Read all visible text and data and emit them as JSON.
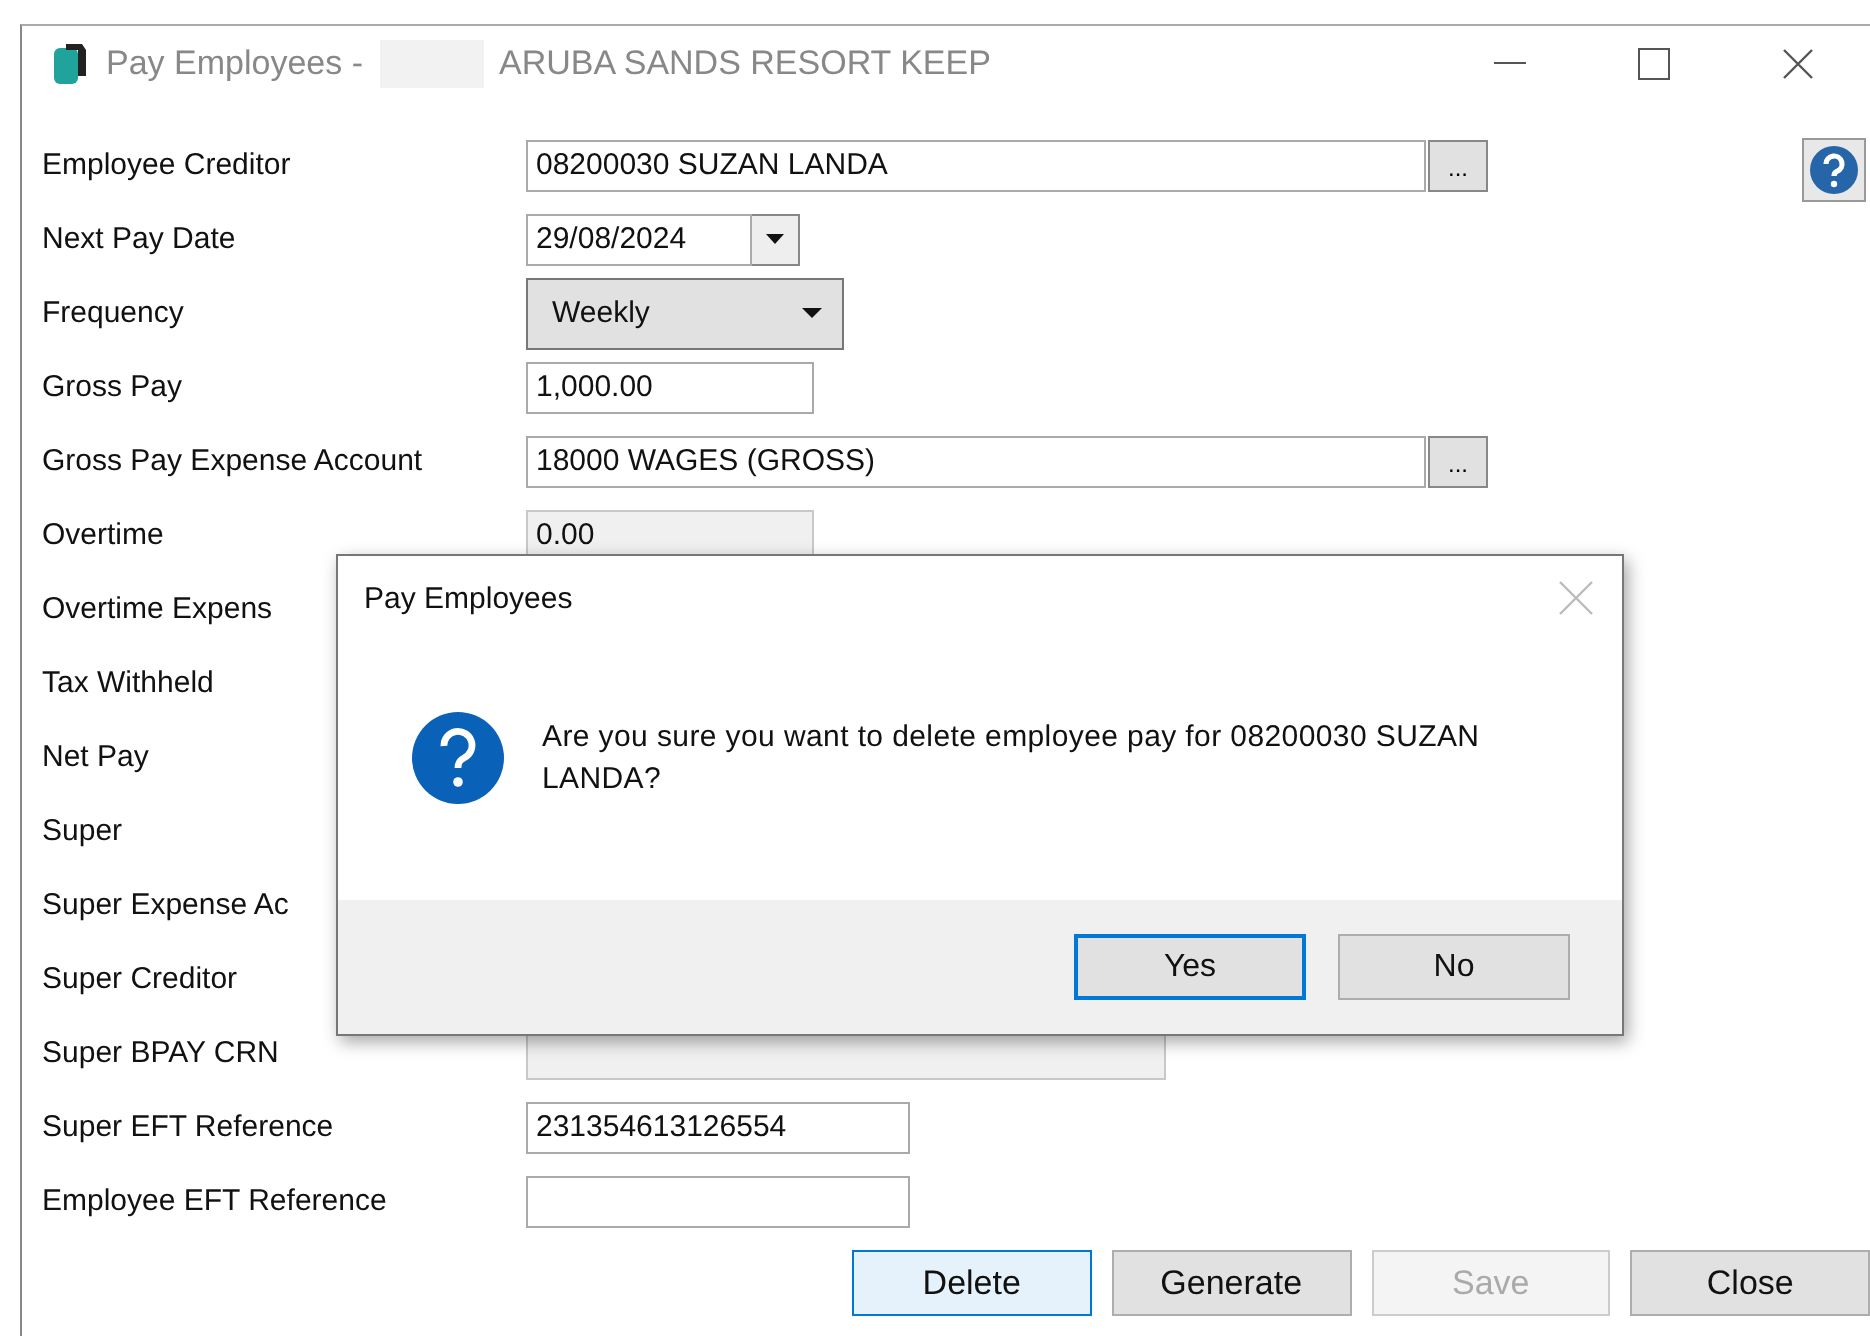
{
  "window": {
    "title": "Pay Employees -",
    "subtitle": "ARUBA SANDS RESORT KEEP"
  },
  "form": {
    "rows": [
      {
        "label": "Employee Creditor",
        "field": {
          "kind": "lookup",
          "value": "08200030 SUZAN LANDA",
          "button_label": "...",
          "disabled": false
        }
      },
      {
        "label": "Next Pay Date",
        "field": {
          "kind": "date",
          "value": "29/08/2024",
          "disabled": false
        }
      },
      {
        "label": "Frequency",
        "field": {
          "kind": "select",
          "value": "Weekly",
          "disabled": false
        }
      },
      {
        "label": "Gross Pay",
        "field": {
          "kind": "amount",
          "value": "1,000.00",
          "disabled": false
        }
      },
      {
        "label": "Gross Pay Expense Account",
        "field": {
          "kind": "lookup",
          "value": "18000 WAGES (GROSS)",
          "button_label": "...",
          "disabled": false
        }
      },
      {
        "label": "Overtime",
        "field": {
          "kind": "amount",
          "value": "0.00",
          "disabled": true
        }
      },
      {
        "label": "Overtime Expens"
      },
      {
        "label": "Tax Withheld"
      },
      {
        "label": "Net Pay"
      },
      {
        "label": "Super"
      },
      {
        "label": "Super Expense Ac"
      },
      {
        "label": "Super Creditor"
      },
      {
        "label": "Super BPAY CRN",
        "field": {
          "kind": "wide",
          "disabled": true
        }
      },
      {
        "label": "Super EFT Reference",
        "field": {
          "kind": "reference",
          "value": "231354613126554",
          "disabled": false
        }
      },
      {
        "label": "Employee EFT Reference",
        "field": {
          "kind": "reference",
          "disabled": false
        }
      }
    ]
  },
  "buttons": [
    {
      "label": "Delete",
      "default": true,
      "disabled": false
    },
    {
      "label": "Generate",
      "default": false,
      "disabled": false
    },
    {
      "label": "Save",
      "default": false,
      "disabled": true
    },
    {
      "label": "Close",
      "default": false,
      "disabled": false
    }
  ],
  "dialog": {
    "title": "Pay Employees",
    "message": "Are you sure you want to delete employee pay for 08200030 SUZAN LANDA?",
    "buttons": [
      {
        "label": "Yes",
        "default": true
      },
      {
        "label": "No",
        "default": false
      }
    ]
  }
}
